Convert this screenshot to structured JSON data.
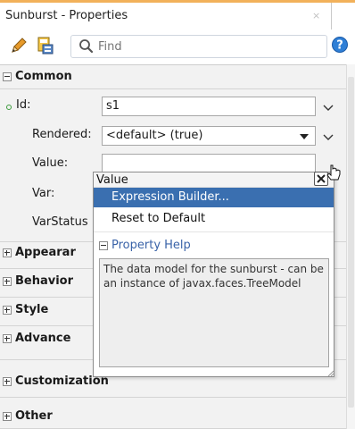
{
  "window": {
    "title": "Sunburst - Properties",
    "close_glyph": "×"
  },
  "toolbar": {
    "edit_icon": "pencil-icon",
    "bind_icon": "data-binding-icon",
    "search_icon": "search-icon",
    "search_placeholder": "Find",
    "help_icon": "help-icon",
    "help_glyph": "?"
  },
  "sections": {
    "common": "Common",
    "appearance": "Appearar",
    "behavior": "Behavior",
    "style": "Style",
    "advanced": "Advance",
    "customization": "Customization",
    "other": "Other"
  },
  "properties": {
    "id": {
      "label": "Id:",
      "value": "s1"
    },
    "rendered": {
      "label": "Rendered:",
      "value": "<default> (true)"
    },
    "value": {
      "label": "Value:",
      "value": ""
    },
    "var": {
      "label": "Var:"
    },
    "varstatus": {
      "label": "VarStatus"
    }
  },
  "popup": {
    "header": "Value",
    "items": [
      "Expression Builder...",
      "Reset to Default"
    ],
    "selected_index": 0,
    "property_help_label": "Property Help",
    "property_help_text": "The data model for the sunburst - can be an instance of javax.faces.TreeModel"
  },
  "colors": {
    "selection": "#3a6fb0",
    "link": "#3a63a8",
    "required_indicator": "#3a9a3a",
    "accent_strip": "#f2b15a"
  }
}
